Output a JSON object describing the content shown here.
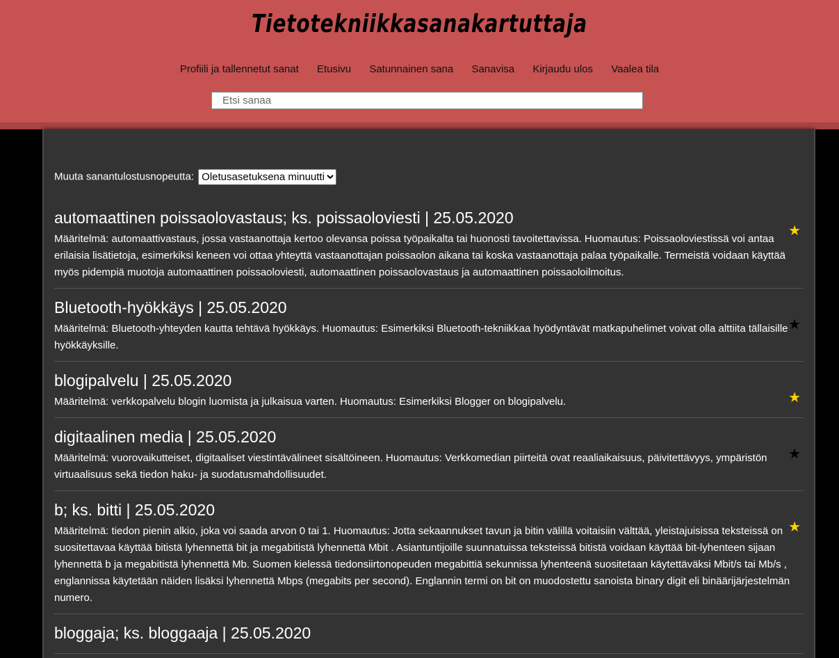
{
  "site": {
    "title": "Tietotekniikkasanakartuttaja"
  },
  "nav": {
    "items": [
      {
        "label": "Profiili ja tallennetut sanat"
      },
      {
        "label": "Etusivu"
      },
      {
        "label": "Satunnainen sana"
      },
      {
        "label": "Sanavisa"
      },
      {
        "label": "Kirjaudu ulos"
      },
      {
        "label": "Vaalea tila"
      }
    ]
  },
  "search": {
    "placeholder": "Etsi sanaa"
  },
  "speed": {
    "label": "Muuta sanantulostusnopeutta:",
    "selected": "Oletusasetuksena minuutti"
  },
  "entries": [
    {
      "title": "automaattinen poissaolovastaus; ks. poissaoloviesti | 25.05.2020",
      "definition": "Määritelmä: automaattivastaus, jossa vastaanottaja kertoo olevansa poissa työpaikalta tai huonosti tavoitettavissa. Huomautus: Poissaoloviestissä voi antaa erilaisia lisätietoja, esimerkiksi keneen voi ottaa yhteyttä vastaanottajan poissaolon aikana tai koska vastaanottaja palaa työpaikalle. Termeistä voidaan käyttää myös pidempiä muotoja automaattinen poissaoloviesti, automaattinen poissaolovastaus ja automaattinen poissaoloilmoitus.",
      "starred": true
    },
    {
      "title": "Bluetooth-hyökkäys | 25.05.2020",
      "definition": "Määritelmä: Bluetooth-yhteyden kautta tehtävä hyökkäys. Huomautus: Esimerkiksi Bluetooth-tekniikkaa hyödyntävät matkapuhelimet voivat olla alttiita tällaisille hyökkäyksille.",
      "starred": false
    },
    {
      "title": "blogipalvelu | 25.05.2020",
      "definition": "Määritelmä: verkkopalvelu blogin luomista ja julkaisua varten. Huomautus: Esimerkiksi Blogger on blogipalvelu.",
      "starred": true
    },
    {
      "title": "digitaalinen media | 25.05.2020",
      "definition": "Määritelmä: vuorovaikutteiset, digitaaliset viestintävälineet sisältöineen. Huomautus: Verkkomedian piirteitä ovat reaaliaikaisuus, päivitettävyys, ympäristön virtuaalisuus sekä tiedon haku- ja suodatusmahdollisuudet.",
      "starred": false
    },
    {
      "title": "b; ks. bitti | 25.05.2020",
      "definition": "Määritelmä: tiedon pienin alkio, joka voi saada arvon 0 tai 1. Huomautus: Jotta sekaannukset tavun ja bitin välillä voitaisiin välttää, yleistajuisissa teksteissä on suositettavaa käyttää bitistä lyhennettä bit ja megabitistä lyhennettä Mbit . Asiantuntijoille suunnatuissa teksteissä bitistä voidaan käyttää bit-lyhenteen sijaan lyhennettä b ja megabitistä lyhennettä Mb. Suomen kielessä tiedonsiirtonopeuden megabittiä sekunnissa lyhenteenä suositetaan käytettäväksi Mbit/s tai Mb/s , englannissa käytetään näiden lisäksi lyhennettä Mbps (megabits per second). Englannin termi on bit on muodostettu sanoista binary digit eli binäärijärjestelmän numero.",
      "starred": true
    },
    {
      "title": "bloggaja; ks. bloggaaja | 25.05.2020",
      "definition": "",
      "starred": false
    }
  ],
  "icons": {
    "star": "star-icon",
    "star_on_color": "#ffd200",
    "star_off_color": "#000000"
  }
}
